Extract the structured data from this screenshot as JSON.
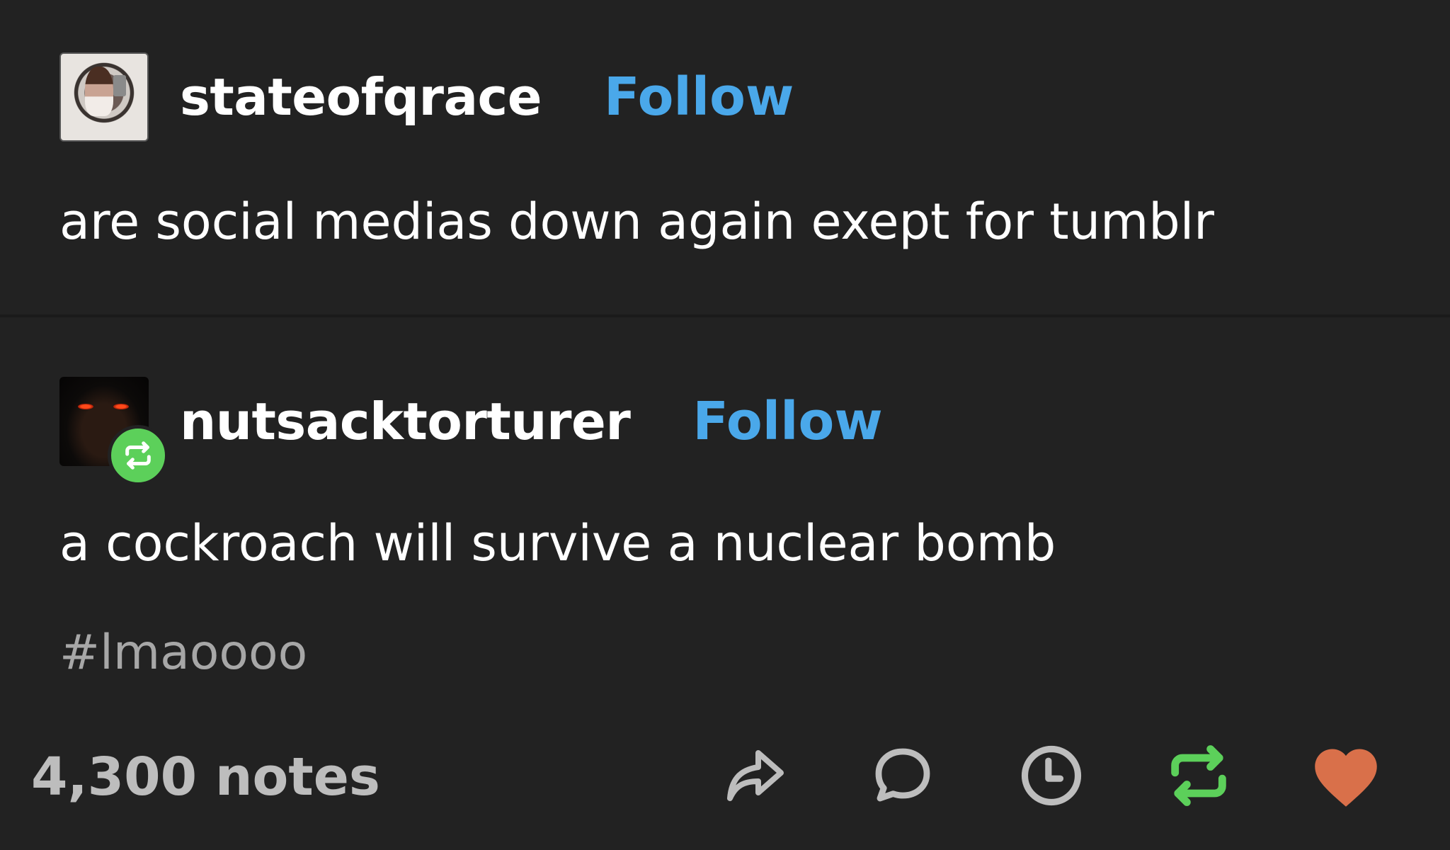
{
  "posts": [
    {
      "username": "stateofqrace",
      "follow_label": "Follow",
      "text": "are social medias down again exept for tumblr"
    },
    {
      "username": "nutsacktorturer",
      "follow_label": "Follow",
      "text": "a cockroach will survive a nuclear bomb",
      "tag": "#lmaoooo"
    }
  ],
  "footer": {
    "notes": "4,300 notes",
    "actions": [
      "share-icon",
      "reply-icon",
      "clock-icon",
      "reblog-icon",
      "like-icon"
    ]
  },
  "colors": {
    "background": "#222222",
    "follow": "#4aa8ea",
    "reblog_green": "#5cd05a",
    "like_red": "#d9704a",
    "icon_gray": "#bdbdbd"
  }
}
